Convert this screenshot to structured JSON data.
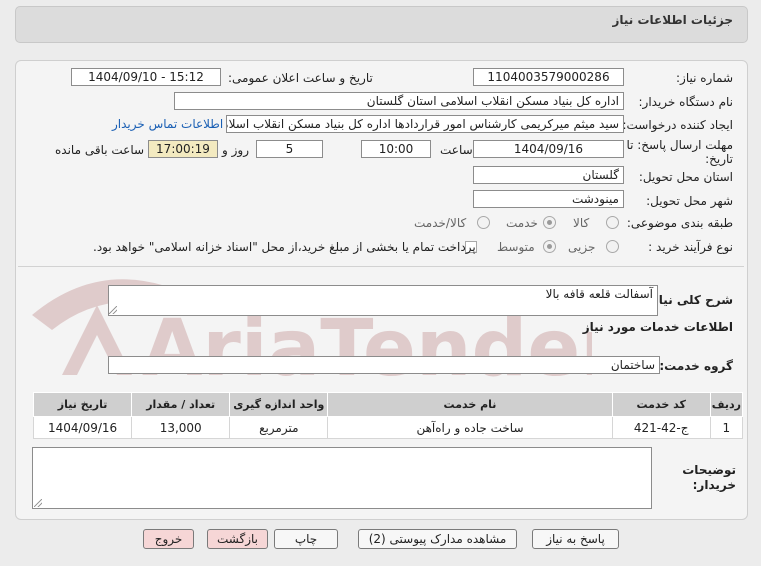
{
  "header": {
    "title": "جزئیات اطلاعات نیاز"
  },
  "form": {
    "need_number_label": "شماره نیاز:",
    "need_number": "1104003579000286",
    "announce_label": "تاریخ و ساعت اعلان عمومی:",
    "announce_value": "1404/09/10 - 15:12",
    "buyer_org_label": "نام دستگاه خریدار:",
    "buyer_org": "اداره کل بنیاد مسکن انقلاب اسلامی استان گلستان",
    "requester_label": "ایجاد کننده درخواست:",
    "requester": "سید میثم میرکریمی کارشناس امور قراردادها اداره کل بنیاد مسکن انقلاب اسلامی استان گلستان",
    "buyer_contact_link": "اطلاعات تماس خریدار",
    "deadline_label_1": "مهلت ارسال پاسخ: تا",
    "deadline_label_2": "تاریخ:",
    "deadline_date": "1404/09/16",
    "time_label": "ساعت",
    "deadline_time": "10:00",
    "days_value": "5",
    "days_label": "روز و",
    "remaining_time": "17:00:19",
    "remaining_label": "ساعت باقی مانده",
    "province_label": "استان محل تحویل:",
    "province": "گلستان",
    "city_label": "شهر محل تحویل:",
    "city": "مینودشت",
    "category_label": "طبقه بندی موضوعی:",
    "category_options": [
      "کالا",
      "خدمت",
      "کالا/خدمت"
    ],
    "category_selected": "خدمت",
    "purchase_type_label": "نوع فرآیند خرید :",
    "purchase_type_options": [
      "جزیی",
      "متوسط"
    ],
    "purchase_type_selected": "متوسط",
    "treasury_note": "پرداخت تمام یا بخشی از مبلغ خرید،از محل \"اسناد خزانه اسلامی\" خواهد بود."
  },
  "need_description": {
    "label": "شرح کلی نیاز:",
    "value": "آسفالت قلعه قافه بالا"
  },
  "services_section": {
    "title": "اطلاعات خدمات مورد نیاز",
    "group_label": "گروه خدمت:",
    "group_value": "ساختمان"
  },
  "table": {
    "headers": [
      "ردیف",
      "کد خدمت",
      "نام خدمت",
      "واحد اندازه گیری",
      "تعداد / مقدار",
      "تاریخ نیاز"
    ],
    "rows": [
      [
        "1",
        "ج-42-421",
        "ساخت جاده و راه‌آهن",
        "مترمربع",
        "13,000",
        "1404/09/16"
      ]
    ]
  },
  "buyer_notes": {
    "label_1": "توضیحات",
    "label_2": "خریدار:",
    "value": ""
  },
  "watermark": {
    "text": "AriaTender.net"
  },
  "buttons": {
    "reply": "پاسخ به نیاز",
    "attachments": "مشاهده مدارک پیوستی (2)",
    "print": "چاپ",
    "back": "بازگشت",
    "exit": "خروج"
  }
}
